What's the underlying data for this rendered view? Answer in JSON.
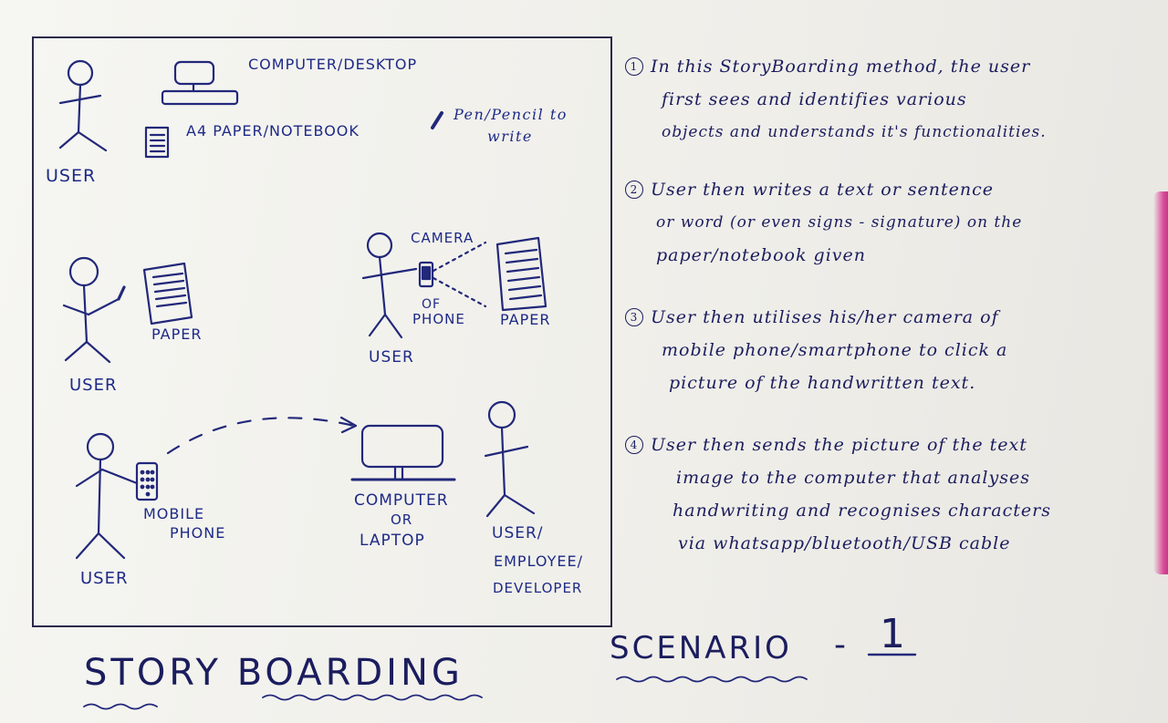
{
  "labels": {
    "user_top": "USER",
    "computer_desktop": "COMPUTER/DESKTOP",
    "a4_paper": "A4 PAPER/NOTEBOOK",
    "pen_line1": "Pen/Pencil to",
    "pen_line2": "write",
    "user_paper": "USER",
    "paper_mid": "PAPER",
    "camera": "CAMERA",
    "of_label": "OF",
    "phone_label": "PHONE",
    "paper_right": "PAPER",
    "user_camera": "USER",
    "user_bottom": "USER",
    "mobile_line1": "MOBILE",
    "mobile_line2": "PHONE",
    "computer_line1": "COMPUTER",
    "computer_line2": "OR",
    "computer_line3": "LAPTOP",
    "dev_line1": "USER/",
    "dev_line2": "EMPLOYEE/",
    "dev_line3": "DEVELOPER"
  },
  "notes": [
    {
      "num": "1",
      "line1": "In this StoryBoarding method, the user",
      "line2": "first sees and identifies various",
      "line3": "objects and understands it's functionalities."
    },
    {
      "num": "2",
      "line1": "User then writes a text or sentence",
      "line2": "or word (or even signs - signature) on the",
      "line3": "paper/notebook given"
    },
    {
      "num": "3",
      "line1": "User then utilises his/her camera of",
      "line2": "mobile phone/smartphone to click a",
      "line3": "picture of the handwritten text."
    },
    {
      "num": "4",
      "line1": "User then sends the picture of the text",
      "line2": "image to the computer that analyses",
      "line3": "handwriting and recognises characters",
      "line4": "via whatsapp/bluetooth/USB cable"
    }
  ],
  "footer": {
    "title": "STORY BOARDING",
    "scenario": "SCENARIO",
    "dash": "-",
    "number": "1"
  },
  "colors": {
    "ink_blue": "#1e2a86",
    "ink_dark": "#1b1d5e",
    "paper": "#f1f0ec",
    "pink_edge": "#d94a98"
  }
}
